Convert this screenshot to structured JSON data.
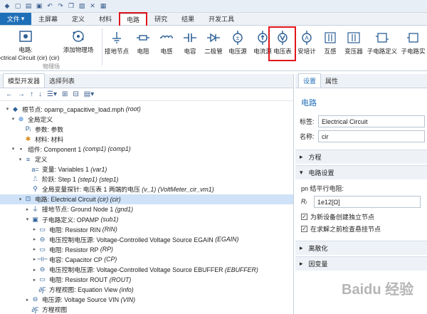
{
  "menubar": {
    "file": "文件",
    "tabs": [
      "主屏幕",
      "定义",
      "材料",
      "电路",
      "研究",
      "结果",
      "开发工具"
    ],
    "active_tab": "电路"
  },
  "ribbon": {
    "circuit_btn": "Electrical Circuit (cir) (cir)",
    "circuit_prefix": "电路:",
    "add_physics": "添加物理场",
    "physics_group": "物理场",
    "buttons": [
      "接地节点",
      "电阻",
      "电感",
      "电容",
      "二极管",
      "电压源",
      "电流源",
      "电压表",
      "安培计",
      "互感",
      "变压器",
      "子电路定义",
      "子电路实"
    ],
    "highlighted": "电压表"
  },
  "left": {
    "tabs": [
      "模型开发器",
      "选择列表"
    ],
    "tree": [
      {
        "text": "根节点: opamp_capacitive_load.mph",
        "it": "(root)"
      },
      {
        "text": "全局定义",
        "it": ""
      },
      {
        "text": "参数: 参数",
        "it": ""
      },
      {
        "text": "材料: 材料",
        "it": ""
      },
      {
        "text": "组件: Component 1",
        "it": "(comp1) (comp1)"
      },
      {
        "text": "定义",
        "it": ""
      },
      {
        "text": "变量: Variables 1",
        "it": "(var1)"
      },
      {
        "text": "阶跃: Step 1",
        "it": "(step1) (step1)"
      },
      {
        "text": "全局变量探针: 电压表 1 两端的电压",
        "it": "(v_1) (VoltMeter_cir_vm1)"
      },
      {
        "text": "电路: Electrical Circuit",
        "it": "(cir) (cir)"
      },
      {
        "text": "接地节点: Ground Node 1",
        "it": "(gnd1)"
      },
      {
        "text": "子电路定义: OPAMP",
        "it": "(sub1)"
      },
      {
        "text": "电阻: Resistor RIN",
        "it": "(RIN)"
      },
      {
        "text": "电压控制电压源: Voltage-Controlled Voltage Source EGAIN",
        "it": "(EGAIN)"
      },
      {
        "text": "电阻: Resistor RP",
        "it": "(RP)"
      },
      {
        "text": "电容: Capacitor CP",
        "it": "(CP)"
      },
      {
        "text": "电压控制电压源: Voltage-Controlled Voltage Source EBUFFER",
        "it": "(EBUFFER)"
      },
      {
        "text": "电阻: Resistor ROUT",
        "it": "(ROUT)"
      },
      {
        "text": "方程视图: Equation View",
        "it": "(info)"
      },
      {
        "text": "电压源: Voltage Source VIN",
        "it": "(VIN)"
      },
      {
        "text": "方程视图",
        "it": ""
      }
    ]
  },
  "right": {
    "tabs": [
      "设置",
      "属性"
    ],
    "heading": "电路",
    "label_key": "标签:",
    "label_val": "Electrical Circuit",
    "name_key": "名称:",
    "name_val": "cir",
    "sec_equation": "方程",
    "sec_circuit": "电路设置",
    "pn_label": "pn 结平行电阻:",
    "r_symbol": "Rⱼ",
    "r_value": "1e12[Ω]",
    "chk1": "为新设备创建独立节点",
    "chk2": "在求解之前检查悬挂节点",
    "sec_discrete": "离散化",
    "sec_dependent": "因变量"
  },
  "watermark": "Baidu 经验"
}
